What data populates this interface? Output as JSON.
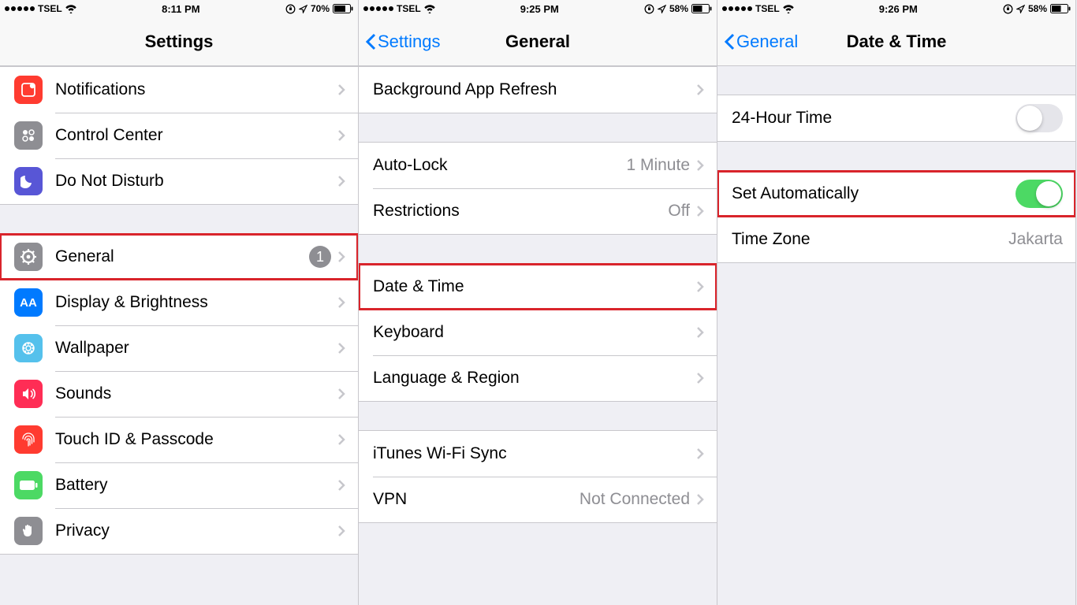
{
  "screen1": {
    "status": {
      "carrier": "TSEL",
      "time": "8:11 PM",
      "battery": "70%"
    },
    "nav": {
      "title": "Settings"
    },
    "group1": [
      {
        "key": "notifications",
        "label": "Notifications",
        "icon": "notifications-icon"
      },
      {
        "key": "controlcenter",
        "label": "Control Center",
        "icon": "control-center-icon"
      },
      {
        "key": "dnd",
        "label": "Do Not Disturb",
        "icon": "moon-icon"
      }
    ],
    "group2": [
      {
        "key": "general",
        "label": "General",
        "icon": "gear-icon",
        "badge": "1",
        "highlight": true
      },
      {
        "key": "display",
        "label": "Display & Brightness",
        "icon": "display-icon"
      },
      {
        "key": "wallpaper",
        "label": "Wallpaper",
        "icon": "wallpaper-icon"
      },
      {
        "key": "sounds",
        "label": "Sounds",
        "icon": "speaker-icon"
      },
      {
        "key": "touchid",
        "label": "Touch ID & Passcode",
        "icon": "fingerprint-icon"
      },
      {
        "key": "battery",
        "label": "Battery",
        "icon": "battery-icon"
      },
      {
        "key": "privacy",
        "label": "Privacy",
        "icon": "hand-icon"
      }
    ]
  },
  "screen2": {
    "status": {
      "carrier": "TSEL",
      "time": "9:25 PM",
      "battery": "58%"
    },
    "nav": {
      "back": "Settings",
      "title": "General"
    },
    "group1": [
      {
        "key": "bgrefresh",
        "label": "Background App Refresh"
      }
    ],
    "group2": [
      {
        "key": "autolock",
        "label": "Auto-Lock",
        "detail": "1 Minute"
      },
      {
        "key": "restrictions",
        "label": "Restrictions",
        "detail": "Off"
      }
    ],
    "group3": [
      {
        "key": "datetime",
        "label": "Date & Time",
        "highlight": true
      },
      {
        "key": "keyboard",
        "label": "Keyboard"
      },
      {
        "key": "langregion",
        "label": "Language & Region"
      }
    ],
    "group4": [
      {
        "key": "itunes",
        "label": "iTunes Wi-Fi Sync"
      },
      {
        "key": "vpn",
        "label": "VPN",
        "detail": "Not Connected"
      }
    ]
  },
  "screen3": {
    "status": {
      "carrier": "TSEL",
      "time": "9:26 PM",
      "battery": "58%"
    },
    "nav": {
      "back": "General",
      "title": "Date & Time"
    },
    "group1": [
      {
        "key": "24hour",
        "label": "24-Hour Time",
        "switch": false
      }
    ],
    "group2": [
      {
        "key": "setauto",
        "label": "Set Automatically",
        "switch": true,
        "highlight": true
      },
      {
        "key": "timezone",
        "label": "Time Zone",
        "detail": "Jakarta",
        "no_chevron": true
      }
    ]
  }
}
